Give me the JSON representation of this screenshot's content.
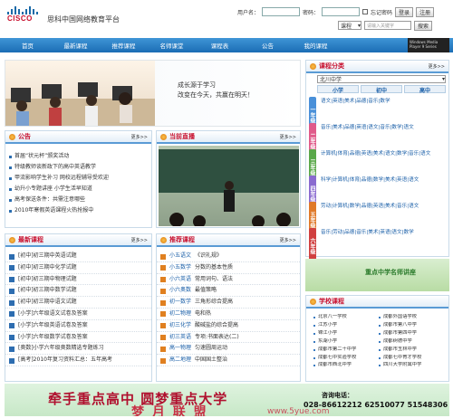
{
  "header": {
    "logo_text": "CISCO",
    "site_title": "思科中国网络教育平台",
    "login": {
      "username_label": "用户名：",
      "password_label": "密码：",
      "remember_label": "忘记密码",
      "login_btn": "登录",
      "register_btn": "注册"
    },
    "search": {
      "type_value": "课程",
      "placeholder": "请输入关键字",
      "search_btn": "搜索"
    }
  },
  "nav": [
    "首页",
    "最新课程",
    "推荐课程",
    "名师课堂",
    "课程表",
    "公告",
    "我的课程"
  ],
  "wmp_label": "Windows Media Player 9 Series",
  "banner": {
    "line1": "成长源于学习",
    "line2": "改变在今天，共赢在明天！"
  },
  "notice": {
    "title": "公告",
    "more": "更多>>",
    "items": [
      "首届“状元杯”颁奖活动",
      "特级教师谈新政下的高中英语教学",
      "甲流影响学生补习 网校远程辅导受欢迎",
      "幼升小专题讲座 小学生活早知道",
      "高考保送条件：共需注意哪些",
      "2010年寒假英语课程火热抢报中"
    ]
  },
  "live": {
    "title": "当前直播",
    "more": "更多>>"
  },
  "latest": {
    "title": "最新课程",
    "more": "更多>>",
    "items": [
      "[初中]初三期中英语试题",
      "[初中]初三期中化学试题",
      "[初中]初三期中物理试题",
      "[初中]初三期中数学试题",
      "[初中]初三期中语文试题",
      "[小学]六年级语文试卷及答案",
      "[小学]六年级英语试卷及答案",
      "[小学]六年级数学试卷及答案",
      "[奥数]小学六年级奥数精选专题练习",
      "[高考]2010年复习资料汇总：五年高考"
    ]
  },
  "recommend": {
    "title": "推荐课程",
    "more": "更多>>",
    "items": [
      [
        "小五语文",
        "《识礼规》"
      ],
      [
        "小五数学",
        "分数的基本性质"
      ],
      [
        "小六英语",
        "常用词句、语法"
      ],
      [
        "小六奥数",
        "最值策略"
      ],
      [
        "初一数学",
        "三角形综合提高"
      ],
      [
        "初二物理",
        "电和热"
      ],
      [
        "初三化学",
        "酸碱盐的综合提高"
      ],
      [
        "初三英语",
        "专项:书面表达(二)"
      ],
      [
        "高一物理",
        "匀速圆周运动"
      ],
      [
        "高二地理",
        "中国国土整治"
      ]
    ]
  },
  "category": {
    "title": "课程分类",
    "more": "更多>>",
    "school_select": "北川中学",
    "tabs": [
      "小学",
      "初中",
      "高中"
    ],
    "subjects": [
      {
        "name": "一年级",
        "color": "#4a90d9",
        "text": "语文|英语|美术|品德|音乐|数学"
      },
      {
        "name": "二年级",
        "color": "#e05a8a",
        "text": "音乐|美术|品德|英语|语文|音乐|数学|语文"
      },
      {
        "name": "三年级",
        "color": "#5aa84a",
        "text": "计算机|体育|品德|英语|美术|语文|数学|音乐|语文"
      },
      {
        "name": "四年级",
        "color": "#8a6ad0",
        "text": "科学|计算机|体育|品德|数学|美术|英语|语文"
      },
      {
        "name": "五年级",
        "color": "#e07a2a",
        "text": "劳动|计算机|数学|品德|英语|美术|音乐|语文"
      },
      {
        "name": "六年级",
        "color": "#d04040",
        "text": "音乐|劳动|品德|音乐|美术|英语|语文|数学"
      }
    ]
  },
  "promo": {
    "text": "重点中学名师讲座"
  },
  "schools": {
    "title": "学校课程",
    "items": [
      "北京八一学校",
      "成都外国语学校",
      "江苏小学",
      "成都市第八中学",
      "锦江小学",
      "成都市第四中学",
      "东湖小学",
      "成都树德中学",
      "成都市第二十中学",
      "成都市玉林中学",
      "成都七中实验学校",
      "成都七中育才学校",
      "成都市西北中学",
      "四川大学附属中学"
    ]
  },
  "footer": {
    "slogan": "牵手重点高中 圆梦重点大学",
    "phone_label": "咨询电话：",
    "phones": "028-86612212  62510077  51548306",
    "watermark": "梦 月 联 盟",
    "url": "www.5yue.com"
  }
}
